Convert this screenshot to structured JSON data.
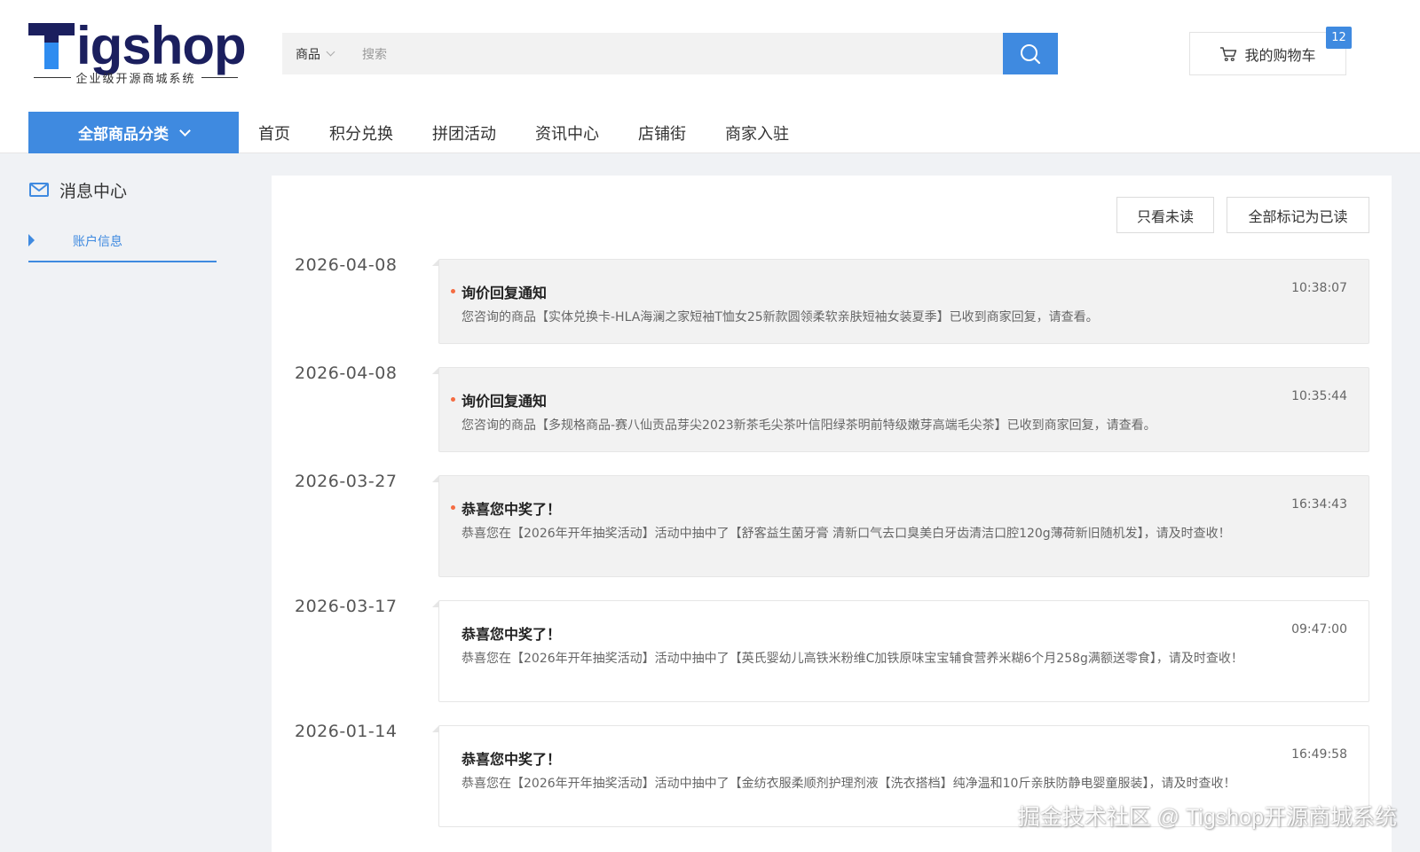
{
  "logo": {
    "brand": "Tigshop",
    "brand_rest": "igshop",
    "tagline": "企业级开源商城系统"
  },
  "search": {
    "category": "商品",
    "placeholder": "搜索"
  },
  "cart": {
    "label": "我的购物车",
    "count": "12"
  },
  "nav": {
    "all_categories": "全部商品分类",
    "items": [
      "首页",
      "积分兑换",
      "拼团活动",
      "资讯中心",
      "店铺街",
      "商家入驻"
    ]
  },
  "sidebar": {
    "title": "消息中心",
    "items": [
      {
        "label": "账户信息",
        "active": true
      }
    ]
  },
  "toolbar": {
    "unread_only": "只看未读",
    "mark_all_read": "全部标记为已读"
  },
  "messages": [
    {
      "date": "2026-04-08",
      "title": "询价回复通知",
      "time": "10:38:07",
      "unread": true,
      "body": "您咨询的商品【实体兑换卡-HLA海澜之家短袖T恤女25新款圆领柔软亲肤短袖女装夏季】已收到商家回复，请查看。"
    },
    {
      "date": "2026-04-08",
      "title": "询价回复通知",
      "time": "10:35:44",
      "unread": true,
      "body": "您咨询的商品【多规格商品-赛八仙贡品芽尖2023新茶毛尖茶叶信阳绿茶明前特级嫩芽高端毛尖茶】已收到商家回复，请查看。"
    },
    {
      "date": "2026-03-27",
      "title": "恭喜您中奖了！",
      "time": "16:34:43",
      "unread": true,
      "body": "恭喜您在【2026年开年抽奖活动】活动中抽中了【舒客益生菌牙膏 清新口气去口臭美白牙齿清洁口腔120g薄荷新旧随机发】，请及时查收！"
    },
    {
      "date": "2026-03-17",
      "title": "恭喜您中奖了！",
      "time": "09:47:00",
      "unread": false,
      "body": "恭喜您在【2026年开年抽奖活动】活动中抽中了【英氏婴幼儿高铁米粉维C加铁原味宝宝辅食营养米糊6个月258g满额送零食】，请及时查收！"
    },
    {
      "date": "2026-01-14",
      "title": "恭喜您中奖了！",
      "time": "16:49:58",
      "unread": false,
      "body": "恭喜您在【2026年开年抽奖活动】活动中抽中了【金纺衣服柔顺剂护理剂液【洗衣搭档】纯净温和10斤亲肤防静电婴童服装】，请及时查收！"
    }
  ],
  "watermark": "掘金技术社区 @ Tigshop开源商城系统",
  "colors": {
    "accent": "#3f8ae0",
    "unread_dot": "#f56c42",
    "logo_dark": "#1b1f5e"
  }
}
